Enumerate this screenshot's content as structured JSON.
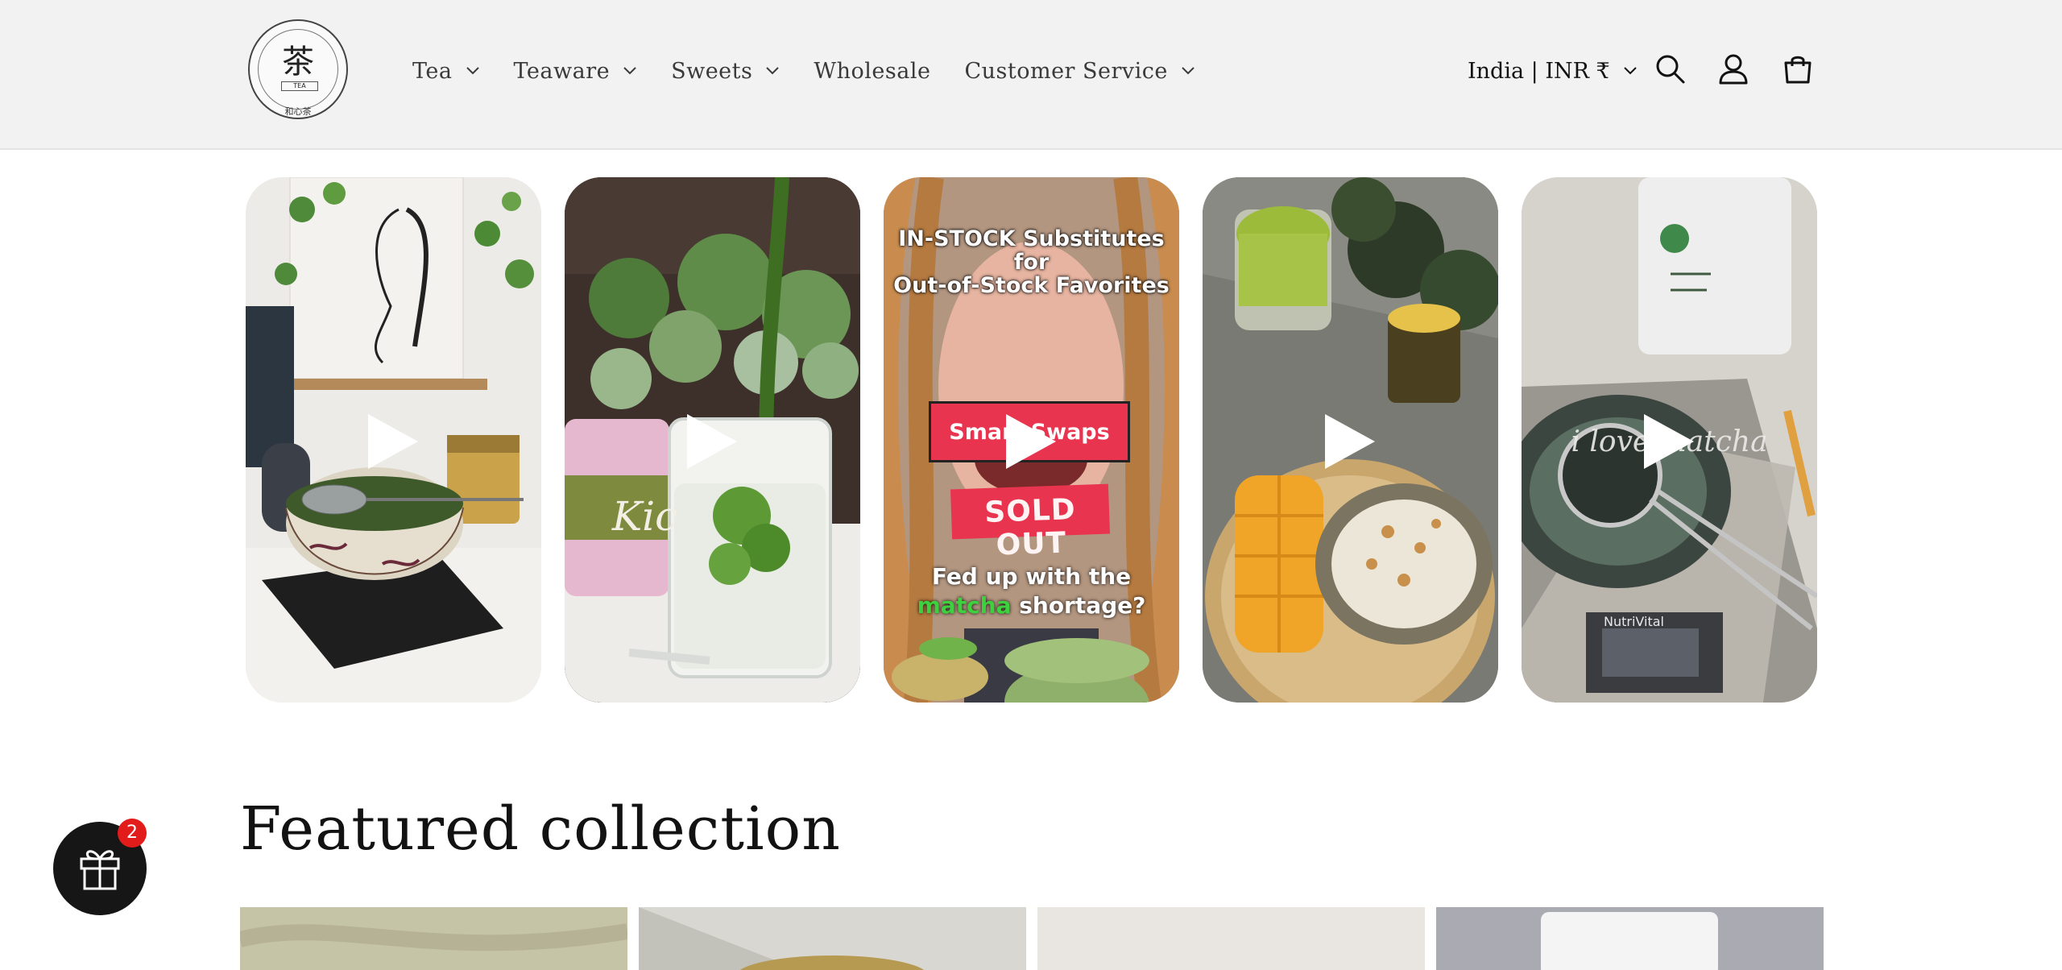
{
  "brand": {
    "logo_kanji": "茶",
    "logo_sub": "和心茶",
    "logo_word": "TEA"
  },
  "nav": {
    "items": [
      {
        "label": "Tea",
        "has_dropdown": true
      },
      {
        "label": "Teaware",
        "has_dropdown": true
      },
      {
        "label": "Sweets",
        "has_dropdown": true
      },
      {
        "label": "Wholesale",
        "has_dropdown": false
      },
      {
        "label": "Customer Service",
        "has_dropdown": true
      }
    ]
  },
  "header_actions": {
    "locale": "India | INR ₹",
    "icons": [
      "search-icon",
      "account-icon",
      "cart-icon"
    ]
  },
  "videos": [
    {
      "caption": ""
    },
    {
      "caption": "Kic"
    },
    {
      "headline": "IN-STOCK Substitutes for Out-of-Stock Favorites",
      "headline_lines": [
        "IN-STOCK Substitutes",
        "for",
        "Out-of-Stock Favorites"
      ],
      "badge": "Smart Swaps",
      "stamp": "SOLD OUT",
      "question_part1": "Fed up with the",
      "question_highlight": "matcha",
      "question_part2": "shortage?"
    },
    {
      "caption": ""
    },
    {
      "caption": "i love matcha",
      "scale_brand": "NutriVital"
    }
  ],
  "featured": {
    "title": "Featured collection"
  },
  "gift_widget": {
    "badge_count": "2"
  },
  "colors": {
    "header_bg": "#f2f2f2",
    "text": "#121212",
    "badge_red": "#e21b1b",
    "matcha_green": "#3ed13e"
  }
}
